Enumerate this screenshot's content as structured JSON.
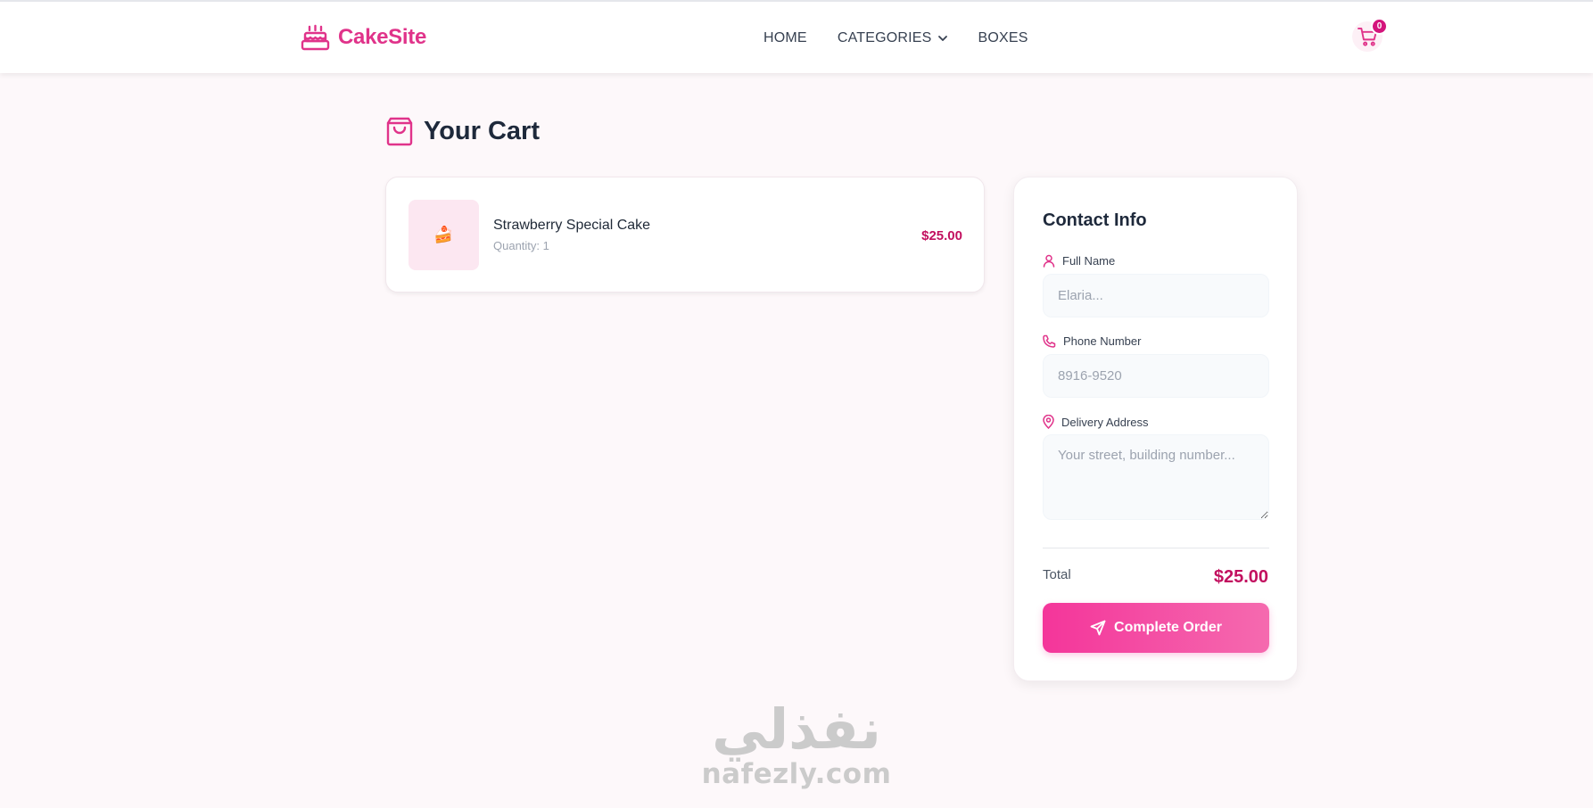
{
  "header": {
    "brand": "CakeSite",
    "nav": {
      "home": "HOME",
      "categories": "CATEGORIES",
      "boxes": "BOXES"
    },
    "cart_count": "0"
  },
  "page": {
    "title": "Your Cart"
  },
  "cart": {
    "items": [
      {
        "name": "Strawberry Special Cake",
        "quantity": "Quantity: 1",
        "price": "$25.00",
        "thumbnail": "🍰"
      }
    ]
  },
  "contact": {
    "title": "Contact Info",
    "full_name_label": "Full Name",
    "full_name_placeholder": "Elaria...",
    "phone_label": "Phone Number",
    "phone_placeholder": "8916-9520",
    "address_label": "Delivery Address",
    "address_placeholder": "Your street, building number...",
    "total_label": "Total",
    "total_value": "$25.00",
    "submit_label": "Complete Order"
  },
  "watermark": {
    "arabic": "نفذلي",
    "latin": "nafezly.com"
  },
  "colors": {
    "accent": "#e0338a",
    "price": "#c2105f",
    "button_start": "#f4359a",
    "button_end": "#f56aaf",
    "page_bg": "#fdf8fa"
  },
  "icons": [
    "cake-icon",
    "chevron-down-icon",
    "cart-icon",
    "shopping-bag-icon",
    "user-icon",
    "phone-icon",
    "map-pin-icon",
    "send-icon"
  ]
}
